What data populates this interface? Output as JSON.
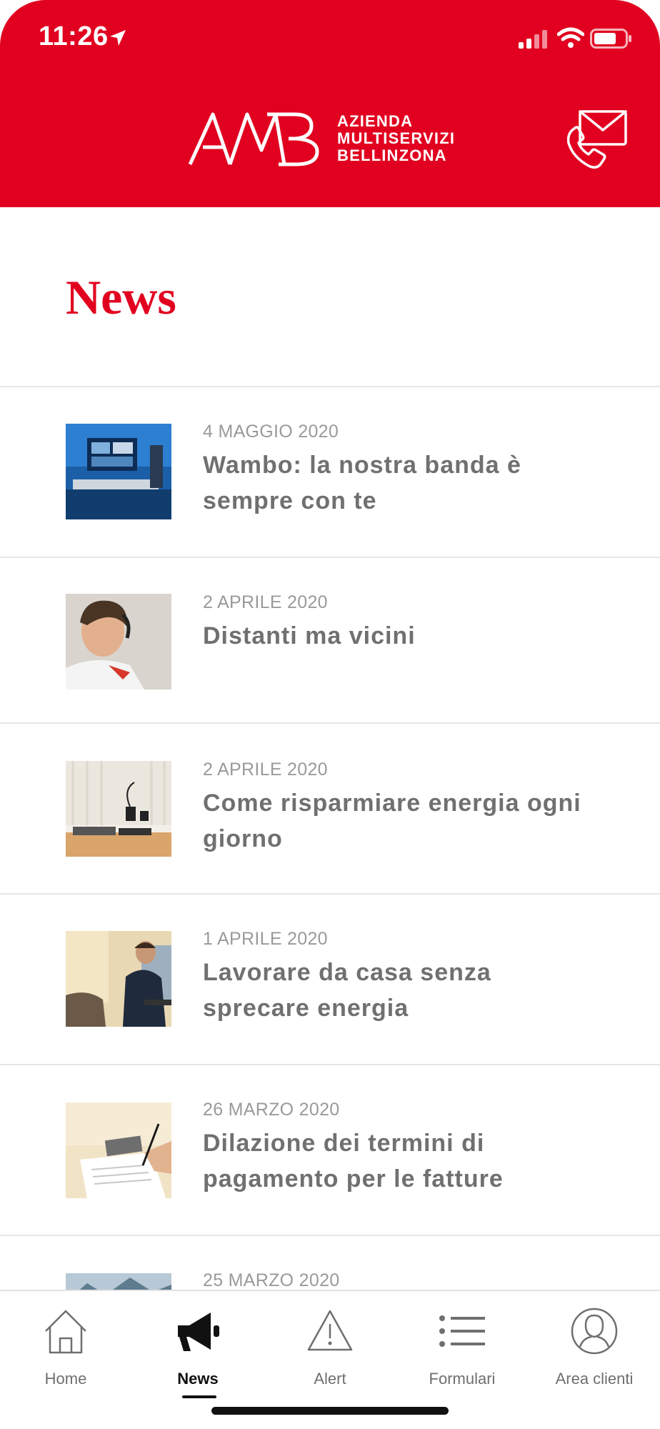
{
  "status_bar": {
    "time": "11:26",
    "icons": [
      "location-arrow-icon",
      "cellular-signal-icon",
      "wifi-icon",
      "battery-icon"
    ]
  },
  "header": {
    "logo_text": "AMB",
    "brand_lines": [
      "AZIENDA",
      "MULTISERVIZI",
      "BELLINZONA"
    ],
    "contact_icon": "mail-phone-icon",
    "background_color": "#e1001f"
  },
  "page": {
    "title": "News",
    "accent_color": "#e1001f"
  },
  "news": [
    {
      "date": "4 MAGGIO 2020",
      "title": "Wambo: la nostra banda è sempre con te",
      "thumb": "studio-desk-image"
    },
    {
      "date": "2 APRILE 2020",
      "title": "Distanti ma vicini",
      "thumb": "customer-service-agent-image"
    },
    {
      "date": "2 APRILE 2020",
      "title": "Come risparmiare energia ogni giorno",
      "thumb": "chargers-devices-image"
    },
    {
      "date": "1 APRILE 2020",
      "title": "Lavorare da casa senza sprecare energia",
      "thumb": "home-office-image"
    },
    {
      "date": "26 MARZO 2020",
      "title": "Dilazione dei termini di pagamento per le fatture",
      "thumb": "paperwork-calculator-image"
    },
    {
      "date": "25 MARZO 2020",
      "title": "",
      "thumb": "mountain-landscape-image"
    }
  ],
  "tabs": [
    {
      "label": "Home",
      "icon": "home-icon",
      "active": false
    },
    {
      "label": "News",
      "icon": "megaphone-icon",
      "active": true
    },
    {
      "label": "Alert",
      "icon": "alert-triangle-icon",
      "active": false
    },
    {
      "label": "Formulari",
      "icon": "list-icon",
      "active": false
    },
    {
      "label": "Area clienti",
      "icon": "user-circle-icon",
      "active": false
    }
  ]
}
